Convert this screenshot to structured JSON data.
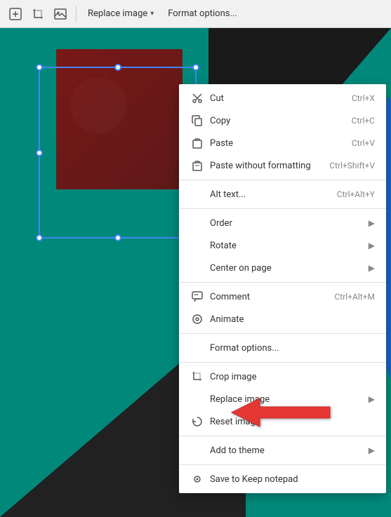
{
  "toolbar": {
    "replace_image_label": "Replace image",
    "replace_image_caret": "▾",
    "format_options_label": "Format options...",
    "crop_icon": "⊡",
    "image_icon": "🖼"
  },
  "context_menu": {
    "items": [
      {
        "id": "cut",
        "icon": "✂",
        "label": "Cut",
        "shortcut": "Ctrl+X",
        "has_arrow": false,
        "separator_after": false
      },
      {
        "id": "copy",
        "icon": "⎘",
        "label": "Copy",
        "shortcut": "Ctrl+C",
        "has_arrow": false,
        "separator_after": false
      },
      {
        "id": "paste",
        "icon": "📋",
        "label": "Paste",
        "shortcut": "Ctrl+V",
        "has_arrow": false,
        "separator_after": false
      },
      {
        "id": "paste-without-formatting",
        "icon": "📄",
        "label": "Paste without formatting",
        "shortcut": "Ctrl+Shift+V",
        "has_arrow": false,
        "separator_after": true
      },
      {
        "id": "alt-text",
        "icon": "",
        "label": "Alt text...",
        "shortcut": "Ctrl+Alt+Y",
        "has_arrow": false,
        "separator_after": true
      },
      {
        "id": "order",
        "icon": "",
        "label": "Order",
        "shortcut": "",
        "has_arrow": true,
        "separator_after": false
      },
      {
        "id": "rotate",
        "icon": "",
        "label": "Rotate",
        "shortcut": "",
        "has_arrow": true,
        "separator_after": false
      },
      {
        "id": "center-on-page",
        "icon": "",
        "label": "Center on page",
        "shortcut": "",
        "has_arrow": true,
        "separator_after": true
      },
      {
        "id": "comment",
        "icon": "💬",
        "label": "Comment",
        "shortcut": "Ctrl+Alt+M",
        "has_arrow": false,
        "separator_after": false
      },
      {
        "id": "animate",
        "icon": "◎",
        "label": "Animate",
        "shortcut": "",
        "has_arrow": false,
        "separator_after": true
      },
      {
        "id": "format-options",
        "icon": "",
        "label": "Format options...",
        "shortcut": "",
        "has_arrow": false,
        "separator_after": true
      },
      {
        "id": "crop-image",
        "icon": "⊡",
        "label": "Crop image",
        "shortcut": "",
        "has_arrow": false,
        "separator_after": false
      },
      {
        "id": "replace-image",
        "icon": "",
        "label": "Replace image",
        "shortcut": "",
        "has_arrow": true,
        "separator_after": false
      },
      {
        "id": "reset-image",
        "icon": "↺",
        "label": "Reset image",
        "shortcut": "",
        "has_arrow": false,
        "separator_after": true
      },
      {
        "id": "add-to-theme",
        "icon": "",
        "label": "Add to theme",
        "shortcut": "",
        "has_arrow": true,
        "separator_after": true
      },
      {
        "id": "save-to-keep",
        "icon": "💡",
        "label": "Save to Keep notepad",
        "shortcut": "",
        "has_arrow": false,
        "separator_after": false
      }
    ]
  },
  "icons": {
    "cut": "✂",
    "copy": "⎘",
    "paste": "⊓",
    "paste_plain": "⊔",
    "alt_text": "",
    "comment": "+",
    "animate": "◎",
    "crop": "⊡",
    "reset": "↺",
    "keep": "💡"
  }
}
